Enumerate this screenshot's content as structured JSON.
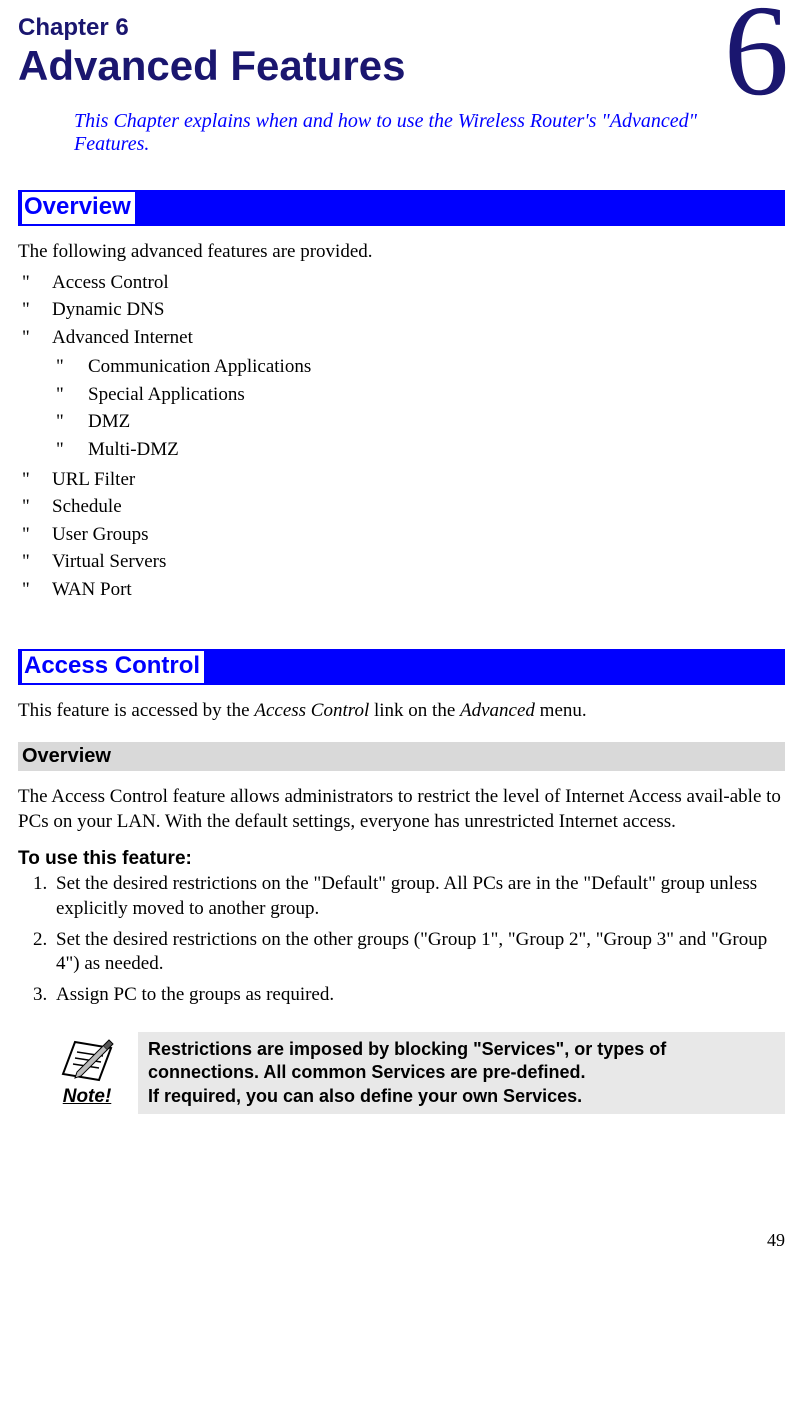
{
  "chapter": {
    "label": "Chapter 6",
    "title": "Advanced Features",
    "number": "6"
  },
  "intro": "This Chapter explains when and how to use the Wireless Router's \"Advanced\" Features.",
  "overview_heading": "Overview",
  "overview_intro": "The following advanced features are provided.",
  "features": [
    "Access Control",
    "Dynamic DNS",
    "Advanced Internet",
    "URL Filter",
    "Schedule",
    "User Groups",
    "Virtual Servers",
    "WAN Port"
  ],
  "advanced_internet_sub": [
    "Communication Applications",
    "Special Applications",
    "DMZ",
    "Multi-DMZ"
  ],
  "access_control": {
    "heading": "Access Control",
    "intro_pre": "This feature is accessed by the ",
    "intro_em1": "Access Control",
    "intro_mid": " link on the ",
    "intro_em2": "Advanced",
    "intro_post": " menu.",
    "overview_label": "Overview",
    "overview_text": "The Access Control feature allows administrators to restrict the level of Internet Access avail-able to PCs on your LAN. With the default settings, everyone has unrestricted Internet access.",
    "howto_label": "To use this feature:",
    "steps": [
      "Set the desired restrictions on the \"Default\" group. All PCs are in the \"Default\" group unless explicitly moved to another group.",
      "Set the desired restrictions on the other groups (\"Group 1\", \"Group 2\", \"Group 3\" and \"Group 4\") as needed.",
      "Assign PC to the groups as required."
    ]
  },
  "note": {
    "icon_label": "Note!",
    "text": "Restrictions are imposed by blocking \"Services\", or types of connections. All common Services are pre-defined.\nIf required, you can also define your own Services."
  },
  "page_number": "49"
}
